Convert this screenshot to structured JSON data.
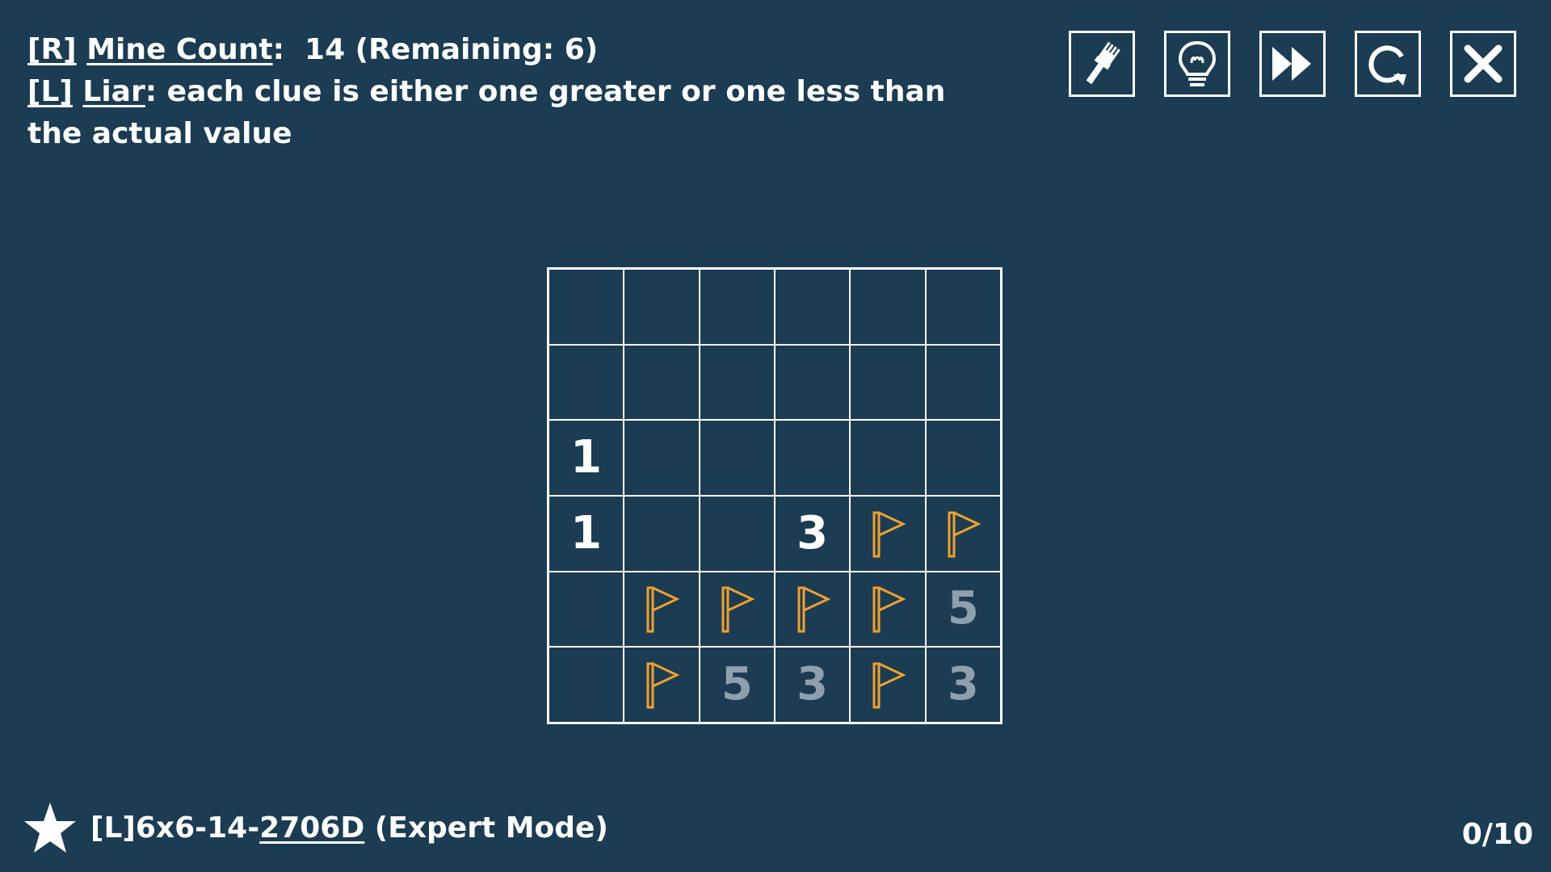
{
  "rules": {
    "mine_key": "[R]",
    "mine_label": "Mine Count",
    "mine_sep": ":",
    "mine_value": "14 (Remaining: 6)",
    "liar_key": "[L]",
    "liar_label": "Liar",
    "liar_text": ": each clue is either one greater or one less than the actual value"
  },
  "toolbar": [
    {
      "name": "paint-brush-icon"
    },
    {
      "name": "lightbulb-hint-icon"
    },
    {
      "name": "fast-forward-icon"
    },
    {
      "name": "restart-icon"
    },
    {
      "name": "close-icon"
    }
  ],
  "board": {
    "rows": 6,
    "cols": 6,
    "flag_color": "#f0a030",
    "cells": [
      [
        "",
        "",
        "",
        "",
        "",
        ""
      ],
      [
        "",
        "",
        "",
        "",
        "",
        ""
      ],
      [
        "1",
        "",
        "",
        "",
        "",
        ""
      ],
      [
        "1",
        "",
        "",
        "3",
        "F",
        "F"
      ],
      [
        "",
        "F",
        "F",
        "F",
        "F",
        "5d"
      ],
      [
        "",
        "F",
        "5d",
        "3d",
        "F",
        "3d"
      ]
    ]
  },
  "footer": {
    "prefix": "[L]6x6-14-",
    "code": "2706D",
    "mode": " (Expert Mode)",
    "progress": "0/10"
  }
}
